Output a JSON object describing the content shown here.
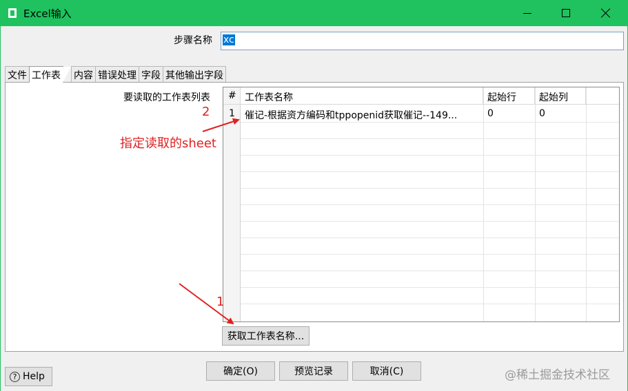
{
  "window": {
    "title": "Excel输入",
    "accent": "#1fc25f"
  },
  "step": {
    "label": "步骤名称",
    "value": "xc"
  },
  "tabs": [
    "文件",
    "工作表",
    "内容",
    "错误处理",
    "字段",
    "其他输出字段"
  ],
  "active_tab": "工作表",
  "sheets": {
    "label": "要读取的工作表列表",
    "columns": [
      "#",
      "工作表名称",
      "起始行",
      "起始列"
    ],
    "rows": [
      {
        "num": "1",
        "name": "催记-根据资方编码和tppopenid获取催记--149...",
        "start_row": "0",
        "start_col": "0"
      }
    ]
  },
  "annotations": {
    "marker_1": "1",
    "marker_2": "2",
    "note": "指定读取的sheet",
    "color": "#e02020"
  },
  "buttons": {
    "get_sheets": "获取工作表名称...",
    "ok": "确定(O)",
    "preview": "预览记录",
    "cancel": "取消(C)",
    "help": "Help"
  },
  "watermark": "@稀土掘金技术社区"
}
